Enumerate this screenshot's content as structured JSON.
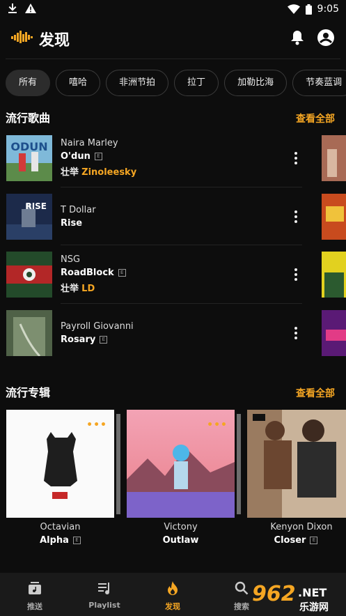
{
  "status_bar": {
    "time": "9:05"
  },
  "header": {
    "title": "发现"
  },
  "genres": [
    "所有",
    "嘻哈",
    "非洲节拍",
    "拉丁",
    "加勒比海",
    "节奏蓝调"
  ],
  "trending_songs": {
    "title": "流行歌曲",
    "see_all": "查看全部",
    "items": [
      {
        "artist": "Naira Marley",
        "title": "O'dun",
        "explicit": "E",
        "feat_label": "壮举",
        "feat": "Zinoleesky"
      },
      {
        "artist": "T Dollar",
        "title": "Rise",
        "explicit": "",
        "feat_label": "",
        "feat": ""
      },
      {
        "artist": "NSG",
        "title": "RoadBlock",
        "explicit": "E",
        "feat_label": "壮举",
        "feat": "LD"
      },
      {
        "artist": "Payroll Giovanni",
        "title": "Rosary",
        "explicit": "E",
        "feat_label": "",
        "feat": ""
      }
    ]
  },
  "trending_albums": {
    "title": "流行专辑",
    "see_all": "查看全部",
    "items": [
      {
        "artist": "Octavian",
        "title": "Alpha",
        "explicit": "E"
      },
      {
        "artist": "Victony",
        "title": "Outlaw",
        "explicit": ""
      },
      {
        "artist": "Kenyon Dixon",
        "title": "Closer",
        "explicit": "E"
      }
    ]
  },
  "bottom_nav": [
    {
      "label": "推送",
      "icon": "feed-icon"
    },
    {
      "label": "Playlist",
      "icon": "playlist-icon"
    },
    {
      "label": "发现",
      "icon": "flame-icon"
    },
    {
      "label": "搜索",
      "icon": "search-icon"
    }
  ],
  "watermark": {
    "number": "962",
    "suffix": ".NET",
    "name": "乐游网"
  },
  "colors": {
    "accent": "#f5a623",
    "background": "#0d0d0d",
    "nav_bg": "#1a1a1a"
  }
}
